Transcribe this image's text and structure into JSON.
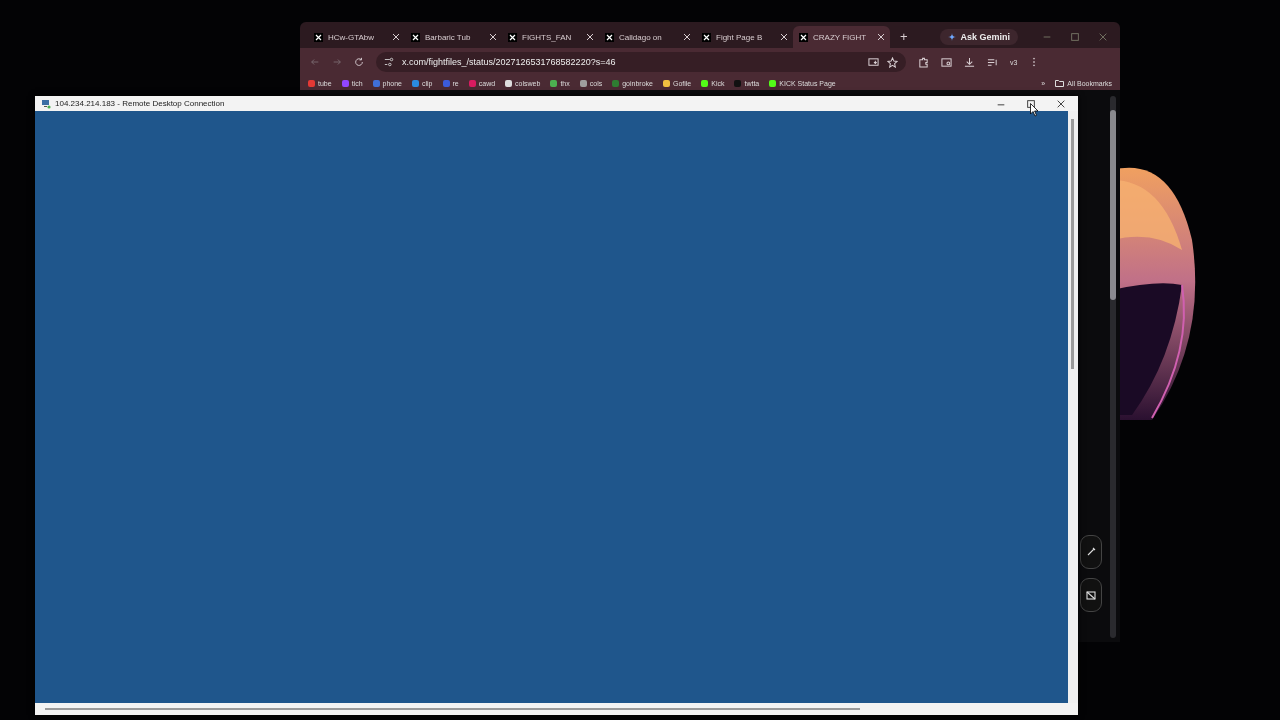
{
  "browser": {
    "tabs": [
      {
        "label": "HCw-GTAbw",
        "selected": false
      },
      {
        "label": "Barbaric Tub",
        "selected": false
      },
      {
        "label": "FIGHTS_FAN",
        "selected": false
      },
      {
        "label": "Calldago on",
        "selected": false
      },
      {
        "label": "Fight Page B",
        "selected": false
      },
      {
        "label": "CRAZY FIGHT",
        "selected": true
      }
    ],
    "new_tab": "+",
    "ask_button": "Ask Gemini",
    "address": "x.com/fightfiles_/status/2027126531768582220?s=46",
    "profile": "v3",
    "bookmarks": [
      {
        "label": "tube",
        "color": "#e53935"
      },
      {
        "label": "tich",
        "color": "#9146ff"
      },
      {
        "label": "phone",
        "color": "#3f6fd8"
      },
      {
        "label": "clip",
        "color": "#2a8be0"
      },
      {
        "label": "re",
        "color": "#3b5bdb"
      },
      {
        "label": "cawd",
        "color": "#d81b60"
      },
      {
        "label": "colsweb",
        "color": "#dddddd"
      },
      {
        "label": "thx",
        "color": "#4caf50"
      },
      {
        "label": "cols",
        "color": "#9e9e9e"
      },
      {
        "label": "goinbroke",
        "color": "#2e7d32"
      },
      {
        "label": "Gofile",
        "color": "#f0c040"
      },
      {
        "label": "Kick",
        "color": "#53fc18"
      },
      {
        "label": "twtta",
        "color": "#111111"
      },
      {
        "label": "KICK Status Page",
        "color": "#53fc18"
      }
    ],
    "more": "»",
    "all_bookmarks": "All Bookmarks"
  },
  "remote_window": {
    "title": "104.234.214.183 - Remote Desktop Connection"
  }
}
